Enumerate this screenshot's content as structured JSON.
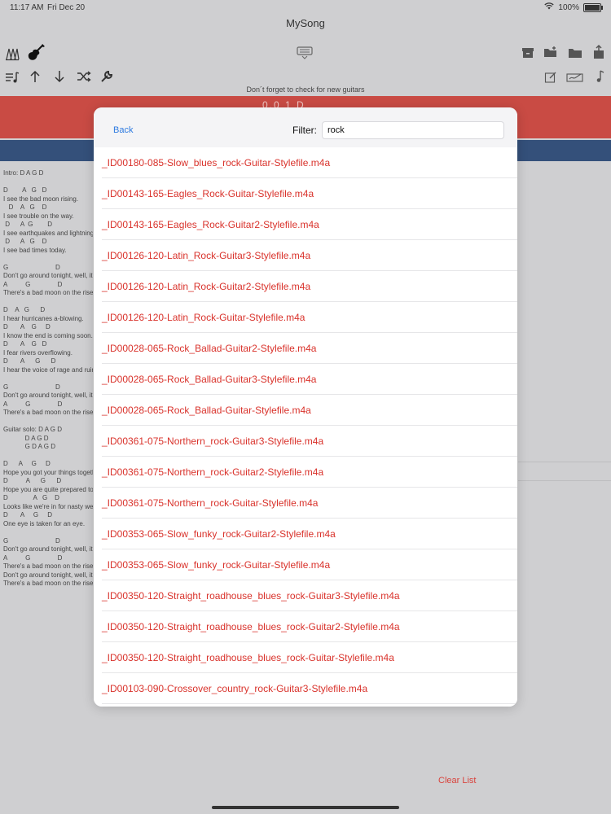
{
  "status": {
    "time": "11:17 AM",
    "date": "Fri Dec 20",
    "battery": "100%"
  },
  "app": {
    "title": "MySong"
  },
  "notice": "Don´t forget to check for new guitars",
  "transport": {
    "values": "0.0      1      D"
  },
  "lyrics": "Intro: D A G D\n\nD        A   G   D\nI see the bad moon rising.\n   D    A   G    D\nI see trouble on the way.\n D      A  G        D\nI see earthquakes and lightning.\n D      A   G    D\nI see bad times today.\n\nG                          D\nDon't go around tonight, well, it's bound to take your life.\nA          G               D\nThere's a bad moon on the rise.\n\nD    A   G      D\nI hear hurricanes a-blowing.\nD       A    G     D\nI know the end is coming soon.\nD       A    G   D\nI fear rivers overflowing.\nD       A      G      D\nI hear the voice of rage and ruin.\n\nG                          D\nDon't go around tonight, well, it's bound to take your life.\nA          G               D\nThere's a bad moon on the rise.\n\nGuitar solo: D A G D\n            D A G D\n            G D A G D\n\nD      A     G     D\nHope you got your things together.\nD          A      G      D\nHope you are quite prepared to die.\nD              A   G    D\nLooks like we're in for nasty weather.\nD       A     G     D\nOne eye is taken for an eye.\n\nG                          D\nDon't go around tonight, well, it's bound to take your life.\nA          G               D\nThere's a bad moon on the rise.\nDon't go around tonight, well, it's bound to take your life.\nThere's a bad moon on the rise.",
  "toolbar": {
    "icons": [
      "tuner-icon",
      "guitar-icon",
      "keyboard-icon",
      "archive-icon",
      "folder-add-icon",
      "folder-icon",
      "share-icon",
      "music-list-icon",
      "arrow-up-icon",
      "arrow-down-icon",
      "shuffle-icon",
      "wrench-icon",
      "edit-icon",
      "signature-icon",
      "music-note-icon"
    ]
  },
  "modal": {
    "back_label": "Back",
    "filter_label": "Filter:",
    "filter_value": "rock",
    "items": [
      "_ID00180-085-Slow_blues_rock-Guitar-Stylefile.m4a",
      "_ID00143-165-Eagles_Rock-Guitar-Stylefile.m4a",
      "_ID00143-165-Eagles_Rock-Guitar2-Stylefile.m4a",
      "_ID00126-120-Latin_Rock-Guitar3-Stylefile.m4a",
      "_ID00126-120-Latin_Rock-Guitar2-Stylefile.m4a",
      "_ID00126-120-Latin_Rock-Guitar-Stylefile.m4a",
      "_ID00028-065-Rock_Ballad-Guitar2-Stylefile.m4a",
      "_ID00028-065-Rock_Ballad-Guitar3-Stylefile.m4a",
      "_ID00028-065-Rock_Ballad-Guitar-Stylefile.m4a",
      "_ID00361-075-Northern_rock-Guitar3-Stylefile.m4a",
      "_ID00361-075-Northern_rock-Guitar2-Stylefile.m4a",
      "_ID00361-075-Northern_rock-Guitar-Stylefile.m4a",
      "_ID00353-065-Slow_funky_rock-Guitar2-Stylefile.m4a",
      "_ID00353-065-Slow_funky_rock-Guitar-Stylefile.m4a",
      "_ID00350-120-Straight_roadhouse_blues_rock-Guitar3-Stylefile.m4a",
      "_ID00350-120-Straight_roadhouse_blues_rock-Guitar2-Stylefile.m4a",
      "_ID00350-120-Straight_roadhouse_blues_rock-Guitar-Stylefile.m4a",
      "_ID00103-090-Crossover_country_rock-Guitar3-Stylefile.m4a"
    ]
  },
  "footer": {
    "clear_list": "Clear List"
  },
  "colors": {
    "accent_red": "#d9322b",
    "link_blue": "#2d7ae0",
    "header_red": "#c94b44",
    "header_blue": "#34507a"
  }
}
